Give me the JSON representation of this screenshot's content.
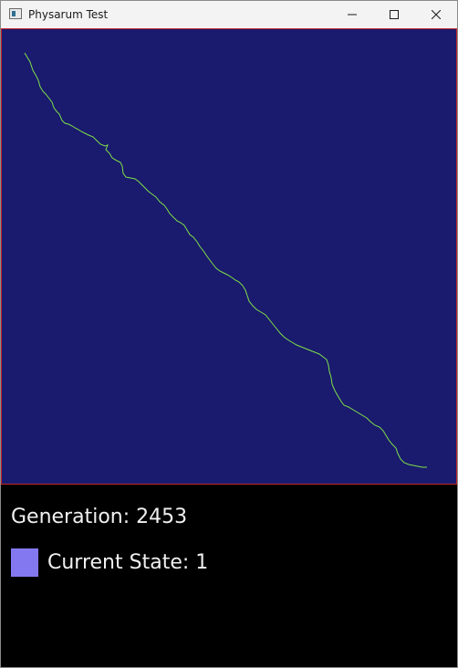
{
  "window": {
    "title": "Physarum Test",
    "icon": "app-window-icon"
  },
  "caption_buttons": {
    "minimize": "minimize-icon",
    "maximize": "maximize-icon",
    "close": "close-icon"
  },
  "simulation": {
    "background_color": "#1a1a6e",
    "border_color": "#c0262a",
    "trail_color": "#7ee04a"
  },
  "status": {
    "generation_label": "Generation:",
    "generation_value": "2453",
    "state_label": "Current State:",
    "state_value": "1",
    "state_color": "#8378f0"
  }
}
